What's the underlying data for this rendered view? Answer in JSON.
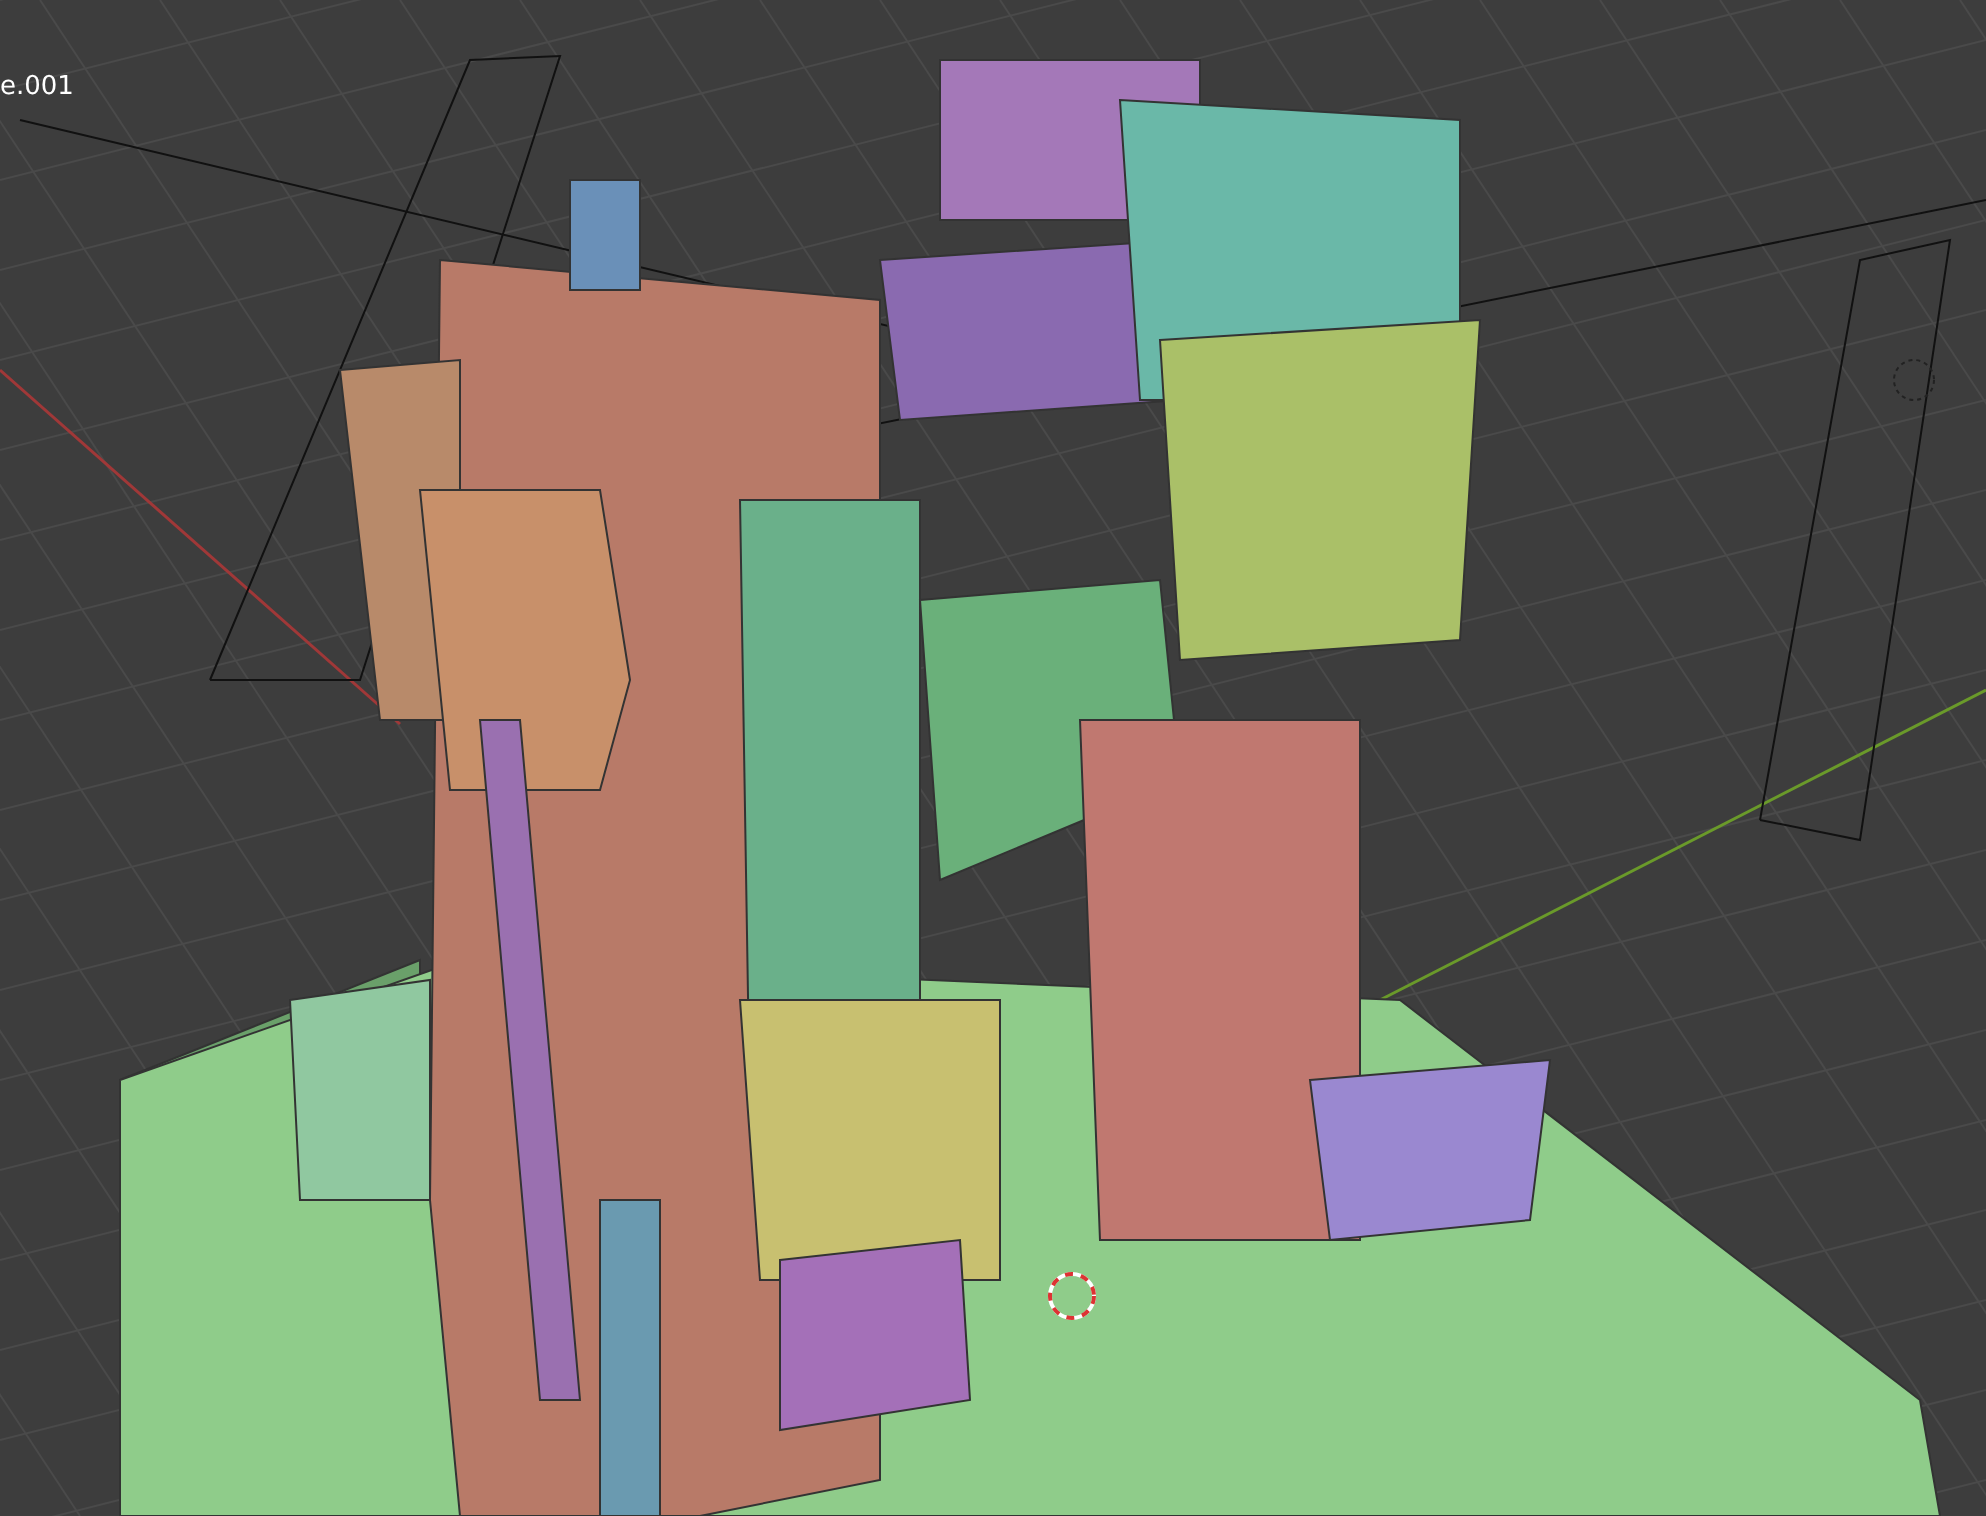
{
  "viewport": {
    "object_label": "e.001"
  }
}
